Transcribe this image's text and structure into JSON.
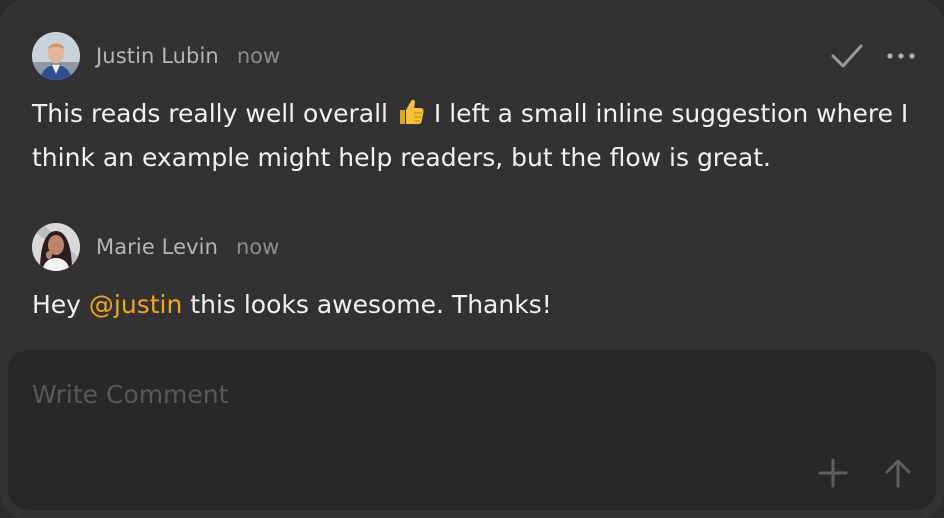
{
  "comments": [
    {
      "author": "Justin Lubin",
      "time": "now",
      "text_before": "This reads really well overall ",
      "emoji": "thumbs-up",
      "text_after": " I left a small inline suggestion where I think an example might help readers, but the flow is great.",
      "actions": [
        "checkmark-icon",
        "more-icon"
      ]
    },
    {
      "author": "Marie Levin",
      "time": "now",
      "text_before": "Hey ",
      "mention": "@justin",
      "text_after": " this looks awesome. Thanks!"
    }
  ],
  "composer": {
    "placeholder": "Write Comment",
    "value": "",
    "buttons": [
      "plus-icon",
      "arrow-up-icon"
    ]
  },
  "colors": {
    "card_background": "#323232",
    "composer_background": "#282828",
    "mention": "#f2a51d",
    "text": "#f1f1f1",
    "author": "#b5b5b5",
    "muted": "#8c8c8c"
  }
}
